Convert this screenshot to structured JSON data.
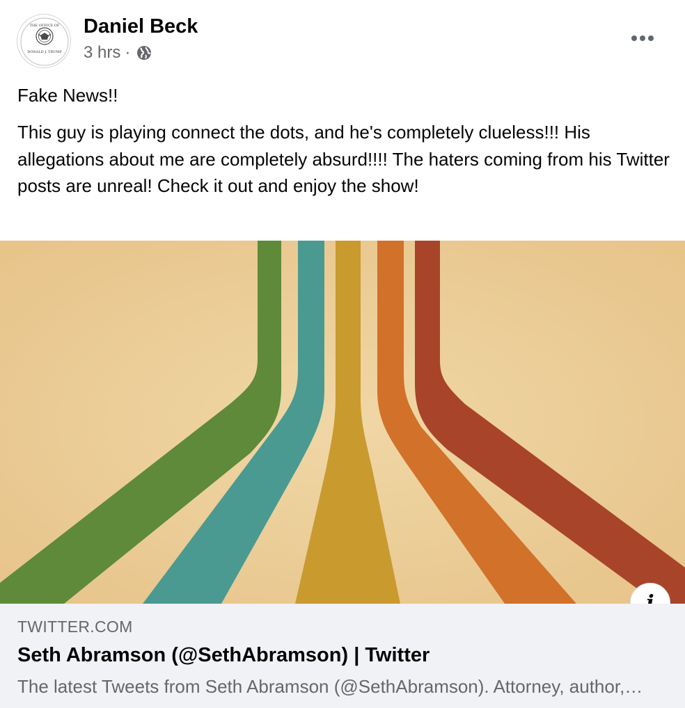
{
  "post": {
    "author": "Daniel Beck",
    "avatar_text": {
      "top": "THE OFFICE OF",
      "bottom": "DONALD J. TRUMP"
    },
    "time": "3 hrs",
    "separator": "·",
    "audience_icon": "globe-icon",
    "more_icon": "more-horizontal-icon",
    "text_line1": "Fake News!!",
    "text_body": "This guy is playing connect the dots, and he's completely clueless!!! His allegations about me are completely absurd!!!! The haters coming from his Twitter posts are unreal! Check it out and enjoy the show!"
  },
  "link": {
    "domain": "TWITTER.COM",
    "title": "Seth Abramson (@SethAbramson) | Twitter",
    "description": "The latest Tweets from Seth Abramson (@SethAbramson). Attorney, author, professor, columnist",
    "info_label": "i",
    "image_colors": [
      "#5e8a3a",
      "#4a9a92",
      "#c99a2e",
      "#d2712a",
      "#a8442a"
    ],
    "image_background": "#edd09a"
  }
}
